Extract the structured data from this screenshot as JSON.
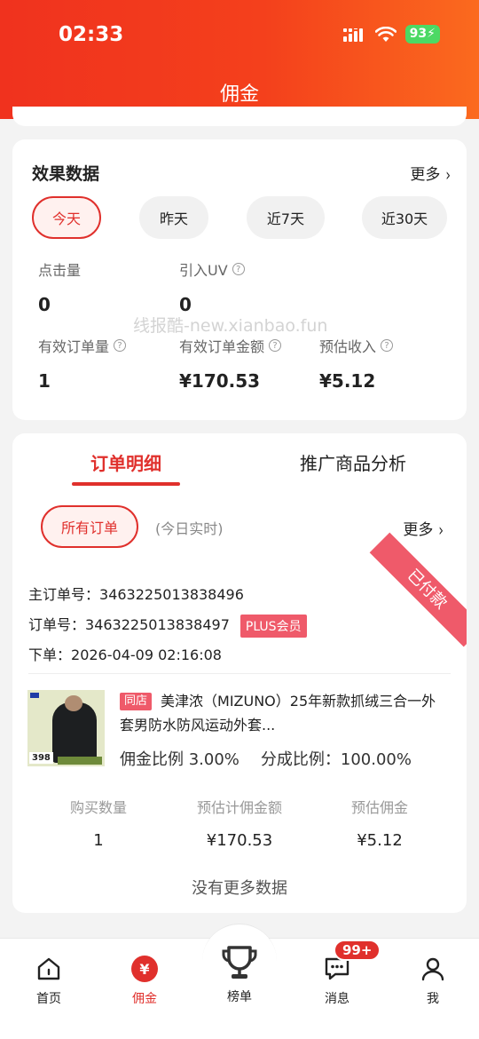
{
  "status_bar": {
    "time": "02:33",
    "battery": "93"
  },
  "header": {
    "title": "佣金"
  },
  "stats": {
    "title": "效果数据",
    "more_label": "更多",
    "periods": [
      "今天",
      "昨天",
      "近7天",
      "近30天"
    ],
    "active_period": "今天",
    "metrics": [
      {
        "label": "点击量",
        "value": "0"
      },
      {
        "label": "引入UV",
        "value": "0"
      },
      {
        "label": "有效订单量",
        "value": "1"
      },
      {
        "label": "有效订单金额",
        "value": "¥170.53"
      },
      {
        "label": "预估收入",
        "value": "¥5.12"
      }
    ],
    "watermark": "线报酷-new.xianbao.fun"
  },
  "orders": {
    "tabs": [
      "订单明细",
      "推广商品分析"
    ],
    "active_tab": "订单明细",
    "filter_label": "所有订单",
    "realtime_label": "(今日实时)",
    "more_label": "更多",
    "order": {
      "status": "已付款",
      "main_order_label": "主订单号：",
      "main_order_no": "3463225013838496",
      "order_label": "订单号：",
      "order_no": "3463225013838497",
      "member_badge": "PLUS会员",
      "placed_label": "下单：",
      "placed_time": "2026-04-09 02:16:08",
      "product": {
        "shop_badge": "同店",
        "title": "美津浓（MIZUNO）25年新款抓绒三合一外套男防水防风运动外套...",
        "image_price": "398",
        "commission_rate": "佣金比例 3.00%",
        "split_rate": "分成比例：100.00%"
      },
      "summary": [
        {
          "label": "购买数量",
          "value": "1"
        },
        {
          "label": "预估计佣金额",
          "value": "¥170.53"
        },
        {
          "label": "预估佣金",
          "value": "¥5.12"
        }
      ]
    },
    "no_more": "没有更多数据"
  },
  "tabbar": {
    "items": [
      {
        "label": "首页",
        "icon": "home-icon"
      },
      {
        "label": "佣金",
        "icon": "yen-icon"
      },
      {
        "label": "榜单",
        "icon": "trophy-icon"
      },
      {
        "label": "消息",
        "icon": "message-icon"
      },
      {
        "label": "我",
        "icon": "user-icon"
      }
    ],
    "active": "佣金",
    "message_badge": "99+"
  },
  "colors": {
    "accent": "#e0302c",
    "header_start": "#f0321e",
    "header_end": "#fb6a1e",
    "badge": "#ef5a6a"
  }
}
